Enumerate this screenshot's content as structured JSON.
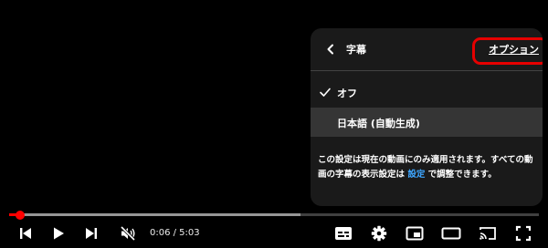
{
  "panel": {
    "title": "字幕",
    "options_label": "オプション",
    "items": [
      {
        "label": "オフ",
        "selected": true
      },
      {
        "label": "日本語 (自動生成)",
        "selected": false
      }
    ],
    "note_before": "この設定は現在の動画にのみ適用されます。すべての動画の字幕の表示設定は",
    "note_link": "設定",
    "note_after": "で調整できます。"
  },
  "player": {
    "current_time": "0:06",
    "duration": "5:03",
    "time_display": "0:06 / 5:03",
    "played_fraction": 0.02,
    "loaded_fraction": 0.55,
    "muted": true
  },
  "colors": {
    "accent_red": "#ff0000",
    "link_blue": "#3ea6ff",
    "highlight_ring": "#e60000"
  },
  "icons": {
    "back": "chevron-left-icon",
    "check": "check-icon",
    "prev": "skip-previous-icon",
    "play": "play-icon",
    "next": "skip-next-icon",
    "volume": "volume-muted-icon",
    "subtitles": "subtitles-icon",
    "settings": "gear-icon",
    "miniplayer": "miniplayer-icon",
    "theater": "theater-mode-icon",
    "cast": "cast-icon",
    "fullscreen": "fullscreen-icon"
  }
}
